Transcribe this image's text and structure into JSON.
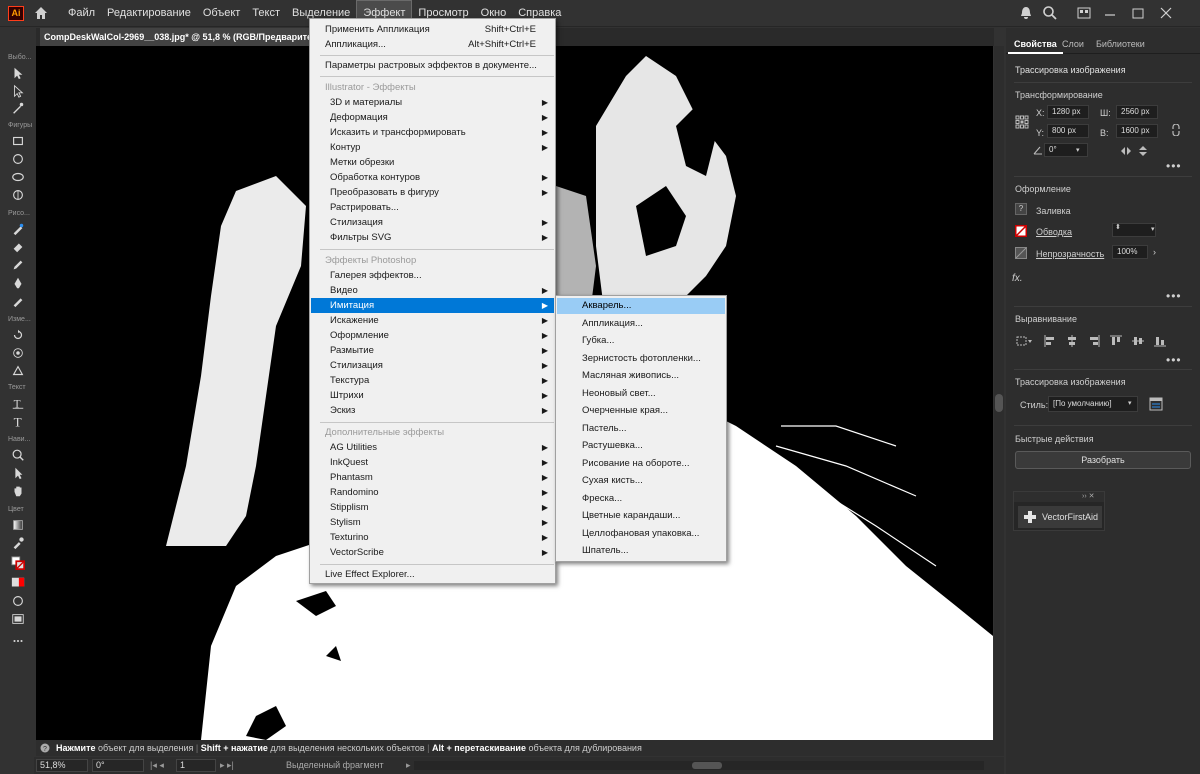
{
  "menubar": {
    "logo": "Ai",
    "items": [
      "Файл",
      "Редактирование",
      "Объект",
      "Текст",
      "Выделение",
      "Эффект",
      "Просмотр",
      "Окно",
      "Справка"
    ],
    "active_index": 5
  },
  "toolbar": {
    "labels": [
      "Выбо...",
      "Фигуры",
      "Рисо...",
      "Изме...",
      "Текст",
      "Нави...",
      "Цвет"
    ]
  },
  "document": {
    "tab_title": "CompDeskWalCol-2969__038.jpg* @ 51,8 % (RGB/Предварительный просмотр)"
  },
  "effect_menu": {
    "top_items": [
      {
        "label": "Применить Аппликация",
        "shortcut": "Shift+Ctrl+E"
      },
      {
        "label": "Аппликация...",
        "shortcut": "Alt+Shift+Ctrl+E"
      },
      {
        "label": "Параметры растровых эффектов в документе..."
      }
    ],
    "section_illustrator": "Illustrator - Эффекты",
    "illustrator_items": [
      {
        "label": "3D и материалы",
        "sub": true
      },
      {
        "label": "Деформация",
        "sub": true
      },
      {
        "label": "Исказить и трансформировать",
        "sub": true
      },
      {
        "label": "Контур",
        "sub": true
      },
      {
        "label": "Метки обрезки",
        "sub": false
      },
      {
        "label": "Обработка контуров",
        "sub": true
      },
      {
        "label": "Преобразовать в фигуру",
        "sub": true
      },
      {
        "label": "Растрировать...",
        "sub": false
      },
      {
        "label": "Стилизация",
        "sub": true
      },
      {
        "label": "Фильтры SVG",
        "sub": true
      }
    ],
    "section_photoshop": "Эффекты Photoshop",
    "photoshop_items": [
      {
        "label": "Галерея эффектов...",
        "sub": false
      },
      {
        "label": "Видео",
        "sub": true
      },
      {
        "label": "Имитация",
        "sub": true
      },
      {
        "label": "Искажение",
        "sub": true
      },
      {
        "label": "Оформление",
        "sub": true
      },
      {
        "label": "Размытие",
        "sub": true
      },
      {
        "label": "Стилизация",
        "sub": true
      },
      {
        "label": "Текстура",
        "sub": true
      },
      {
        "label": "Штрихи",
        "sub": true
      },
      {
        "label": "Эскиз",
        "sub": true
      }
    ],
    "highlighted": "Имитация",
    "section_extra": "Дополнительные эффекты",
    "extra_items": [
      {
        "label": "AG Utilities",
        "sub": true
      },
      {
        "label": "InkQuest",
        "sub": true
      },
      {
        "label": "Phantasm",
        "sub": true
      },
      {
        "label": "Randomino",
        "sub": true
      },
      {
        "label": "Stipplism",
        "sub": true
      },
      {
        "label": "Stylism",
        "sub": true
      },
      {
        "label": "Texturino",
        "sub": true
      },
      {
        "label": "VectorScribe",
        "sub": true
      }
    ],
    "bottom_item": "Live Effect Explorer..."
  },
  "imitation_submenu": {
    "items": [
      "Акварель...",
      "Аппликация...",
      "Губка...",
      "Зернистость фотопленки...",
      "Масляная живопись...",
      "Неоновый свет...",
      "Очерченные края...",
      "Пастель...",
      "Растушевка...",
      "Рисование на обороте...",
      "Сухая кисть...",
      "Фреска...",
      "Цветные карандаши...",
      "Целлофановая упаковка...",
      "Шпатель..."
    ],
    "highlighted_index": 0
  },
  "right_panel": {
    "tabs": [
      "Свойства",
      "Слои",
      "Библиотеки"
    ],
    "active_tab": 0,
    "header": "Трассировка изображения",
    "transform_title": "Трансформирование",
    "x_label": "X:",
    "x_value": "1280 px",
    "w_label": "Ш:",
    "w_value": "2560 px",
    "y_label": "Y:",
    "y_value": "800 px",
    "h_label": "В:",
    "h_value": "1600 px",
    "angle_value": "0°",
    "appearance_title": "Оформление",
    "fill_label": "Заливка",
    "stroke_label": "Обводка",
    "opacity_label": "Непрозрачность",
    "opacity_value": "100%",
    "fx_label": "fx.",
    "align_title": "Выравнивание",
    "trace_title": "Трассировка изображения",
    "style_label": "Стиль:",
    "style_value": "[По умолчанию]",
    "quick_title": "Быстрые действия",
    "quick_button": "Разобрать",
    "plugin_button": "VectorFirstAid"
  },
  "status": {
    "hint_1_bold": "Нажмите",
    "hint_1": " объект для выделения",
    "hint_2_bold": "Shift + нажатие",
    "hint_2": " для выделения нескольких объектов",
    "hint_3_bold": "Alt + перетаскивание",
    "hint_3": " объекта для дублирования"
  },
  "bottombar": {
    "zoom": "51,8%",
    "rotation": "0°",
    "artboard": "1",
    "selection": "Выделенный фрагмент"
  },
  "colors": {
    "menu_highlight": "#0078d7",
    "submenu_highlight": "#99ccf5",
    "ui_dark": "#323232"
  }
}
